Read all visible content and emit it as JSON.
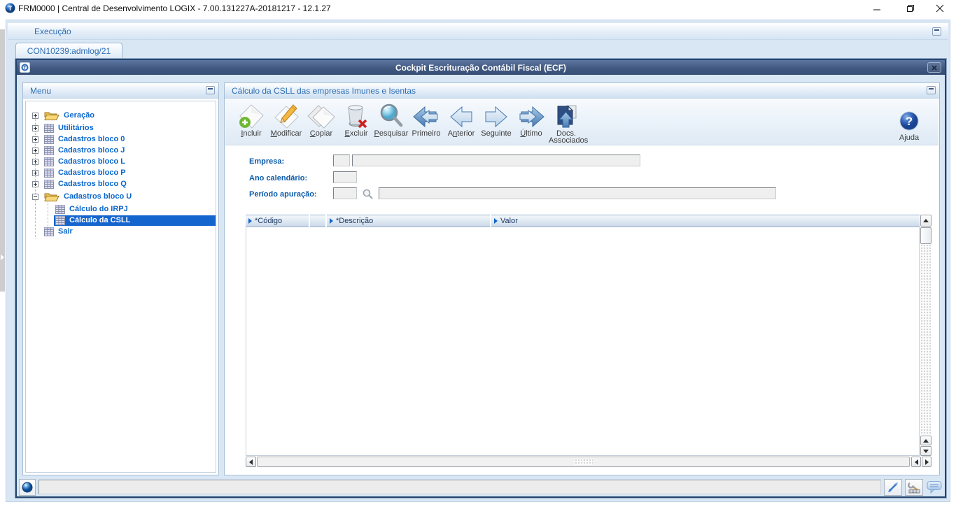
{
  "os": {
    "title": "FRM0000 | Central de Desenvolvimento LOGIX - 7.00.131227A-20181217 - 12.1.27",
    "controls": {
      "minimize": "minimize",
      "restore": "restore",
      "close": "close"
    }
  },
  "app": {
    "section_label": "Execução",
    "tab_label": "CON10239:admlog/21"
  },
  "window": {
    "title": "Cockpit Escrituração Contábil Fiscal (ECF)",
    "title_gradient": "#41597f",
    "close_glyph": "x"
  },
  "menu": {
    "header": "Menu",
    "items": [
      {
        "label": "Geração",
        "icon": "folder-open-icon",
        "expander": "plus"
      },
      {
        "label": "Utilitários",
        "icon": "grid-icon",
        "expander": "plus"
      },
      {
        "label": "Cadastros bloco 0",
        "icon": "grid-icon",
        "expander": "plus"
      },
      {
        "label": "Cadastros bloco J",
        "icon": "grid-icon",
        "expander": "plus"
      },
      {
        "label": "Cadastros bloco L",
        "icon": "grid-icon",
        "expander": "plus"
      },
      {
        "label": "Cadastros bloco P",
        "icon": "grid-icon",
        "expander": "plus"
      },
      {
        "label": "Cadastros bloco Q",
        "icon": "grid-icon",
        "expander": "plus"
      },
      {
        "label": "Cadastros bloco U",
        "icon": "folder-open-icon",
        "expander": "minus"
      },
      {
        "label": "Cálculo do IRPJ",
        "icon": "grid-icon",
        "expander": "none",
        "child": true
      },
      {
        "label": "Cálculo da CSLL",
        "icon": "grid-icon",
        "expander": "none",
        "child": true,
        "selected": true
      },
      {
        "label": "Sair",
        "icon": "grid-icon",
        "expander": "none"
      }
    ],
    "selected_color": "#1565cf"
  },
  "panel": {
    "header": "Cálculo da CSLL das empresas Imunes e Isentas"
  },
  "toolbar": {
    "items": [
      {
        "pre": "",
        "key": "I",
        "post": "ncluir",
        "icon": "new-record-icon"
      },
      {
        "pre": "",
        "key": "M",
        "post": "odificar",
        "icon": "edit-pencil-icon"
      },
      {
        "pre": "",
        "key": "C",
        "post": "opiar",
        "icon": "copy-documents-icon"
      },
      {
        "pre": "",
        "key": "E",
        "post": "xcluir",
        "icon": "trash-delete-icon"
      },
      {
        "pre": "",
        "key": "P",
        "post": "esquisar",
        "icon": "search-magnifier-icon"
      },
      {
        "pre": "Primeiro",
        "key": "",
        "post": "",
        "icon": "first-record-arrow-icon"
      },
      {
        "pre": "A",
        "key": "n",
        "post": "terior",
        "icon": "previous-record-arrow-icon"
      },
      {
        "pre": "Se",
        "key": "g",
        "post": "uinte",
        "icon": "next-record-arrow-icon"
      },
      {
        "pre": "",
        "key": "Ú",
        "post": "ltimo",
        "icon": "last-record-arrow-icon"
      },
      {
        "pre": "Docs.",
        "key": "",
        "post": "Associados",
        "icon": "associated-docs-icon"
      }
    ],
    "help": {
      "label": "Ajuda",
      "icon": "help-icon"
    }
  },
  "form": {
    "empresa_label": "Empresa:",
    "empresa_code": "",
    "empresa_name": "",
    "ano_label": "Ano calendário:",
    "ano_value": "",
    "periodo_label": "Período apuração:",
    "periodo_code": "",
    "periodo_lookup_icon": "search-magnifier-icon",
    "periodo_desc": ""
  },
  "table": {
    "columns": [
      {
        "label": "*Código"
      },
      {
        "label": "*Descrição"
      },
      {
        "label": "Valor"
      }
    ],
    "rows": []
  },
  "statusbar": {
    "message": "",
    "icons": [
      "totvs-orb-icon",
      "resize-diagonal-icon",
      "keyboard-config-icon",
      "chat-bubble-icon"
    ]
  },
  "colors": {
    "accent_blue": "#2e6db4",
    "link_blue": "#0a66cc",
    "selection": "#1565cf",
    "titlebar_navy": "#41597f",
    "app_background": "#d9e7f5"
  }
}
